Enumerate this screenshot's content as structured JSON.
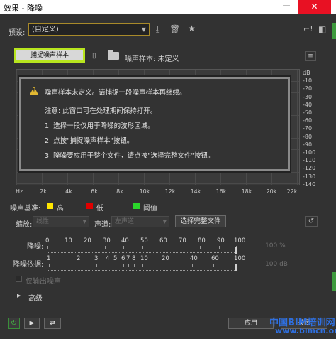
{
  "window": {
    "title": "效果 - 降噪",
    "min_glyph": "—",
    "close_glyph": "✕"
  },
  "preset": {
    "label": "预设:",
    "value": "(自定义)"
  },
  "toolbar_icons": [
    "download-icon",
    "trash-icon",
    "star-icon",
    "fx-icon",
    "help-icon"
  ],
  "capture": {
    "button": "捕捉噪声样本",
    "sample_label": "噪声样本: 未定义"
  },
  "message": {
    "line1": "噪声样本未定义。请捕捉一段噪声样本再继续。",
    "line2": "注意: 此窗口可在处理期间保持打开。",
    "line3": "1. 选择一段仅用于降噪的波形区域。",
    "line4": "2. 点按\"捕捉噪声样本\"按钮。",
    "line5": "3. 降噪要应用于整个文件，请点按\"选择完整文件\"按钮。"
  },
  "graph": {
    "y_ticks": [
      "dB",
      "-10",
      "-20",
      "-30",
      "-40",
      "-50",
      "-60",
      "-70",
      "-80",
      "-90",
      "-100",
      "-110",
      "-120",
      "-130",
      "-140"
    ],
    "x_ticks": [
      "Hz",
      "2k",
      "4k",
      "6k",
      "8k",
      "10k",
      "12k",
      "14k",
      "16k",
      "18k",
      "20k",
      "22k"
    ]
  },
  "legend": {
    "title": "噪声基准:",
    "items": [
      {
        "label": "高",
        "color": "#ffe600"
      },
      {
        "label": "低",
        "color": "#e00000"
      },
      {
        "label": "阈值",
        "color": "#2bd62b"
      }
    ]
  },
  "scale": {
    "label": "缩放:",
    "value": "线性"
  },
  "channel": {
    "label": "声道:",
    "value": "左声道"
  },
  "select_full_file": "选择完整文件",
  "noise_reduction": {
    "label": "降噪:",
    "ticks": [
      "0",
      "10",
      "20",
      "30",
      "40",
      "50",
      "60",
      "70",
      "80",
      "90",
      "100"
    ],
    "value": "100",
    "unit": "%"
  },
  "reduce_by": {
    "label": "降噪依据:",
    "ticks": [
      "1",
      "2",
      "3",
      "4",
      "5",
      "6",
      "7",
      "8",
      "10",
      "20",
      "40",
      "60",
      "100"
    ],
    "value": "100",
    "unit": "dB"
  },
  "output_noise_only": "仅输出噪声",
  "advanced": "高级",
  "buttons": {
    "apply": "应用",
    "close": "关闭"
  },
  "watermark": {
    "line1": "中国BIM培训网",
    "line2": "www.bimcn.org"
  }
}
